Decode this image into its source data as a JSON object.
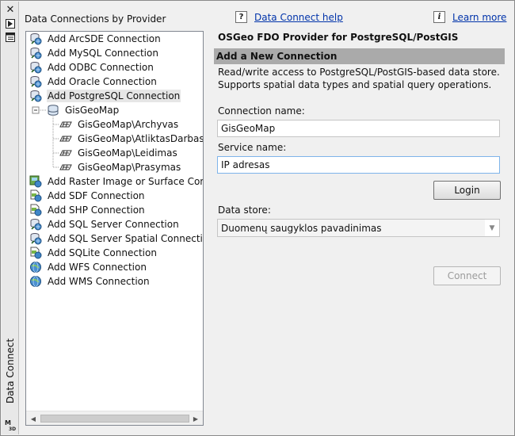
{
  "sidebar": {
    "title": "Data Connect",
    "close_glyph": "✕"
  },
  "left_header": "Data Connections by Provider",
  "tree": {
    "items": [
      {
        "label": "Add ArcSDE Connection",
        "icon": "db-globe-icon"
      },
      {
        "label": "Add MySQL Connection",
        "icon": "db-globe-icon"
      },
      {
        "label": "Add ODBC Connection",
        "icon": "db-globe-icon"
      },
      {
        "label": "Add Oracle Connection",
        "icon": "db-globe-icon"
      },
      {
        "label": "Add PostgreSQL Connection",
        "icon": "db-globe-icon",
        "selected": true
      },
      {
        "label": "GisGeoMap",
        "icon": "database-icon"
      },
      {
        "label": "GisGeoMap\\Archyvas",
        "icon": "layer-icon"
      },
      {
        "label": "GisGeoMap\\AtliktasDarbas",
        "icon": "layer-icon"
      },
      {
        "label": "GisGeoMap\\Leidimas",
        "icon": "layer-icon"
      },
      {
        "label": "GisGeoMap\\Prasymas",
        "icon": "layer-icon"
      },
      {
        "label": "Add Raster Image or Surface Connect",
        "icon": "raster-icon"
      },
      {
        "label": "Add SDF Connection",
        "icon": "file-globe-icon"
      },
      {
        "label": "Add SHP Connection",
        "icon": "file-globe-icon"
      },
      {
        "label": "Add SQL Server Connection",
        "icon": "db-globe-icon"
      },
      {
        "label": "Add SQL Server Spatial Connection",
        "icon": "db-globe-icon"
      },
      {
        "label": "Add SQLite Connection",
        "icon": "file-globe-icon"
      },
      {
        "label": "Add WFS Connection",
        "icon": "globe-icon"
      },
      {
        "label": "Add WMS Connection",
        "icon": "globe-icon"
      }
    ]
  },
  "links": {
    "data_connect_help": "Data Connect help",
    "learn_more": "Learn more",
    "help_glyph": "?",
    "info_glyph": "i"
  },
  "provider_title": "OSGeo FDO Provider for PostgreSQL/PostGIS",
  "section_title": "Add a New Connection",
  "description": [
    "Read/write access to PostgreSQL/PostGIS-based data store.",
    "Supports spatial data types and spatial query operations."
  ],
  "form": {
    "connection_name_label": "Connection name:",
    "connection_name_value": "GisGeoMap",
    "service_name_label": "Service name:",
    "service_name_value": "IP adresas",
    "login_label": "Login",
    "data_store_label": "Data store:",
    "data_store_value": "Duomenų saugyklos pavadinimas",
    "connect_label": "Connect"
  },
  "colors": {
    "section_bar": "#aaaaaa",
    "link": "#0033aa"
  }
}
